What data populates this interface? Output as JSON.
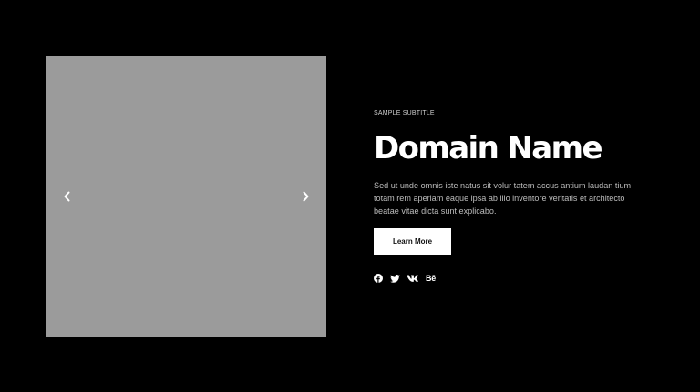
{
  "theme": {
    "background": "#000000",
    "slide_placeholder": "#9b9b9b",
    "text_primary": "#ffffff",
    "text_secondary": "#bdbdbd",
    "button_bg": "#ffffff",
    "button_text": "#111111"
  },
  "slider": {
    "prev_icon": "chevron-left-icon",
    "next_icon": "chevron-right-icon"
  },
  "hero": {
    "subtitle": "SAMPLE SUBTITLE",
    "title": "Domain Name",
    "description": "Sed ut unde omnis iste natus sit volur tatem accus antium laudan tium totam rem aperiam eaque ipsa ab illo inventore veritatis et architecto beatae vitae dicta sunt explicabo.",
    "button_label": "Learn More"
  },
  "social": {
    "items": [
      {
        "icon": "facebook-icon"
      },
      {
        "icon": "twitter-icon"
      },
      {
        "icon": "vk-icon"
      },
      {
        "icon": "behance-icon",
        "label": "Bē"
      }
    ]
  }
}
